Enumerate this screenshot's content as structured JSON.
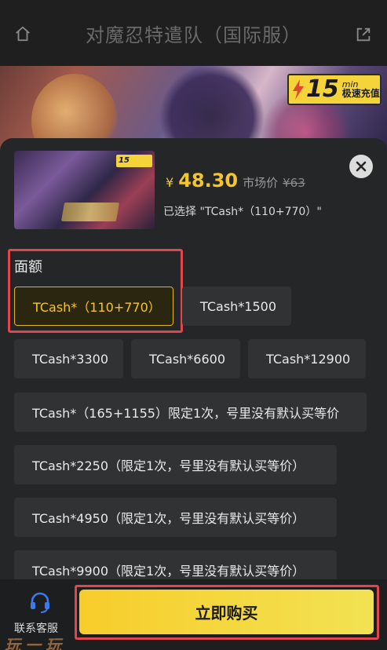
{
  "header": {
    "title": "对魔忍特遣队（国际服）",
    "home_icon": "home-icon",
    "share_icon": "share-icon"
  },
  "banner": {
    "speed_badge": {
      "number": "15",
      "unit": "min",
      "label": "极速充值"
    }
  },
  "product": {
    "currency": "¥",
    "price": "48.30",
    "market_label": "市场价",
    "market_price": "¥63",
    "selected_text": "已选择 \"TCash*（110+770）\"",
    "thumb_badge": "15"
  },
  "denominations": {
    "title": "面额",
    "options": [
      "TCash*（110+770）",
      "TCash*1500",
      "TCash*3300",
      "TCash*6600",
      "TCash*12900",
      "TCash*（165+1155）限定1次，号里没有默认买等价",
      "TCash*2250（限定1次，号里没有默认买等价）",
      "TCash*4950（限定1次，号里没有默认买等价）",
      "TCash*9900（限定1次，号里没有默认买等价）"
    ],
    "selected_index": 0
  },
  "footer": {
    "customer_service": "联系客服",
    "buy": "立即购买",
    "watermark": "玩一玩"
  },
  "colors": {
    "accent": "#f4c52c",
    "highlight_border": "#e0474c",
    "sheet_bg": "#252627"
  }
}
